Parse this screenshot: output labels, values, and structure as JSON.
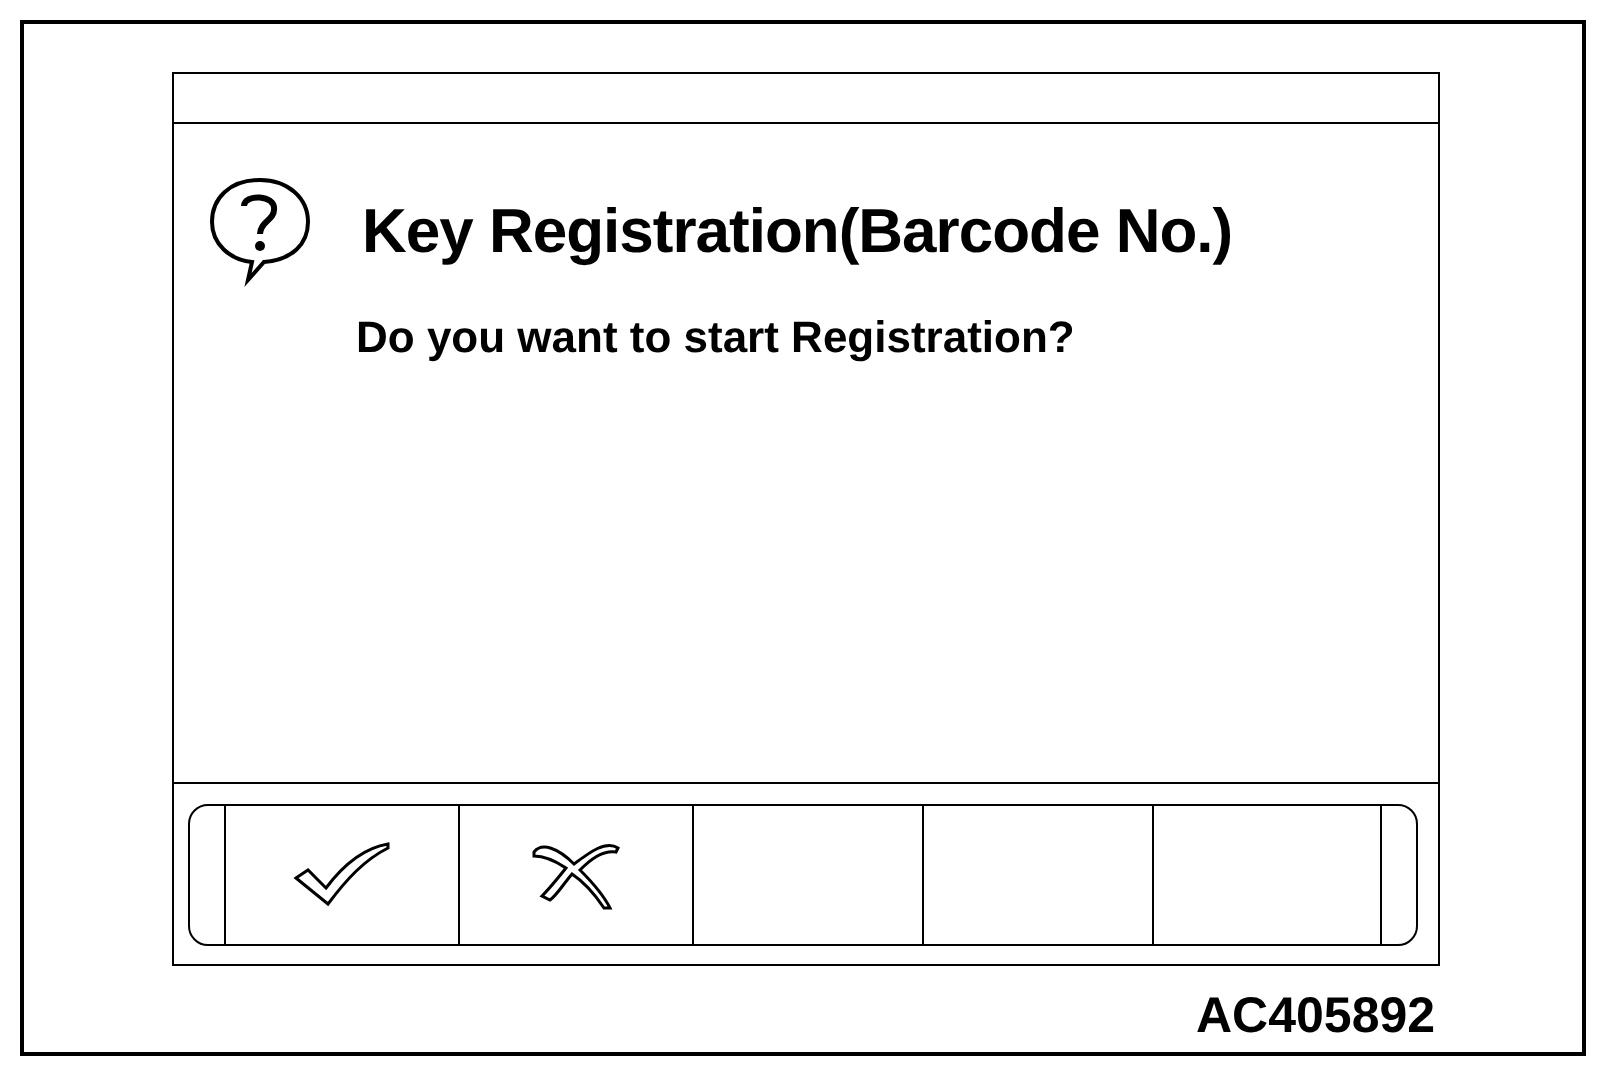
{
  "dialog": {
    "title": "Key Registration(Barcode No.)",
    "message": "Do you want to start Registration?"
  },
  "buttons": [
    {
      "kind": "ok"
    },
    {
      "kind": "cancel"
    },
    {
      "kind": "empty"
    },
    {
      "kind": "empty"
    },
    {
      "kind": "empty"
    }
  ],
  "figure_code": "AC405892"
}
